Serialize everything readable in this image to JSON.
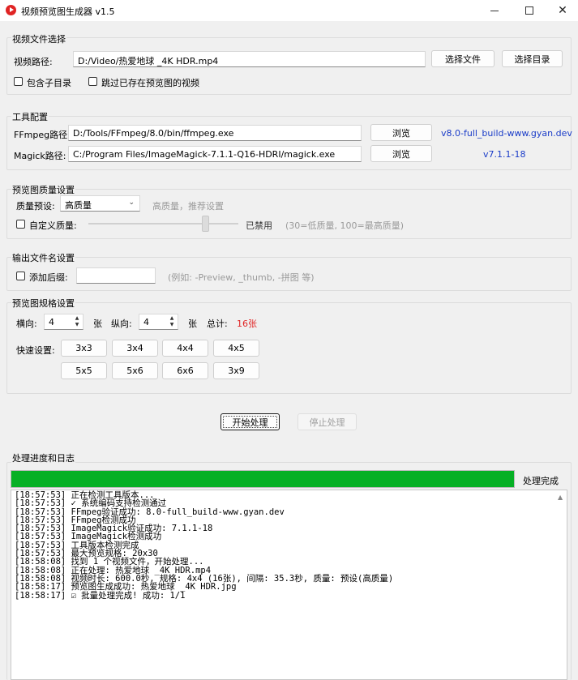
{
  "window": {
    "title": "视频预览图生成器 v1.5",
    "minimize_icon": "minimize-icon",
    "maximize_icon": "maximize-icon",
    "close_icon": "close-icon"
  },
  "video_select": {
    "group_title": "视频文件选择",
    "path_label": "视频路径:",
    "path_value": "D:/Video/热爱地球 _4K HDR.mp4",
    "select_file_label": "选择文件",
    "select_dir_label": "选择目录",
    "include_subdirs_label": "包含子目录",
    "skip_existing_label": "跳过已存在预览图的视频"
  },
  "tools": {
    "group_title": "工具配置",
    "ffmpeg_label": "FFmpeg路径:",
    "ffmpeg_path": "D:/Tools/FFmpeg/8.0/bin/ffmpeg.exe",
    "ffmpeg_browse": "浏览",
    "ffmpeg_version": "v8.0-full_build-www.gyan.dev",
    "magick_label": "Magick路径:",
    "magick_path": "C:/Program Files/ImageMagick-7.1.1-Q16-HDRI/magick.exe",
    "magick_browse": "浏览",
    "magick_version": "v7.1.1-18"
  },
  "quality": {
    "group_title": "预览图质量设置",
    "preset_label": "质量预设:",
    "preset_value": "高质量",
    "preset_hint": "高质量，推荐设置",
    "custom_label": "自定义质量:",
    "custom_status": "已禁用",
    "custom_hint": "(30=低质量, 100=最高质量)",
    "slider_fraction": 0.78
  },
  "output": {
    "group_title": "输出文件名设置",
    "suffix_label": "添加后缀:",
    "suffix_value": "",
    "suffix_hint": "(例如: -Preview, _thumb, -拼图 等)"
  },
  "grid": {
    "group_title": "预览图规格设置",
    "horizontal_label": "横向:",
    "horizontal_value": "4",
    "horizontal_unit": "张",
    "vertical_label": "纵向:",
    "vertical_value": "4",
    "vertical_unit": "张",
    "total_label": "总计:",
    "total_value": "16张",
    "quick_label": "快速设置:",
    "quick_buttons": [
      "3x3",
      "3x4",
      "4x4",
      "4x5",
      "5x5",
      "5x6",
      "6x6",
      "3x9"
    ]
  },
  "actions": {
    "start_label": "开始处理",
    "stop_label": "停止处理"
  },
  "progress": {
    "group_title": "处理进度和日志",
    "value": 1.0,
    "status": "处理完成",
    "color": "#06b025"
  },
  "log": [
    "[18:57:53] 正在检测工具版本...",
    "[18:57:53] ✓ 系统编码支持检测通过",
    "[18:57:53] FFmpeg验证成功: 8.0-full_build-www.gyan.dev",
    "[18:57:53] FFmpeg检测成功",
    "[18:57:53] ImageMagick验证成功: 7.1.1-18",
    "[18:57:53] ImageMagick检测成功",
    "[18:57:53] 工具版本检测完成",
    "[18:57:53] 最大预览规格: 20x30",
    "[18:58:08] 找到 1 个视频文件，开始处理...",
    "[18:58:08] 正在处理: 热爱地球 _4K HDR.mp4",
    "[18:58:08] 视频时长: 600.0秒, 规格: 4x4 (16张), 间隔: 35.3秒, 质量: 预设(高质量)",
    "[18:58:17] 预览图生成成功: 热爱地球 _4K HDR.jpg",
    "[18:58:17] ☑ 批量处理完成! 成功: 1/1"
  ],
  "colors": {
    "accent_link": "#1a3cc8",
    "total_red": "#e02424"
  }
}
